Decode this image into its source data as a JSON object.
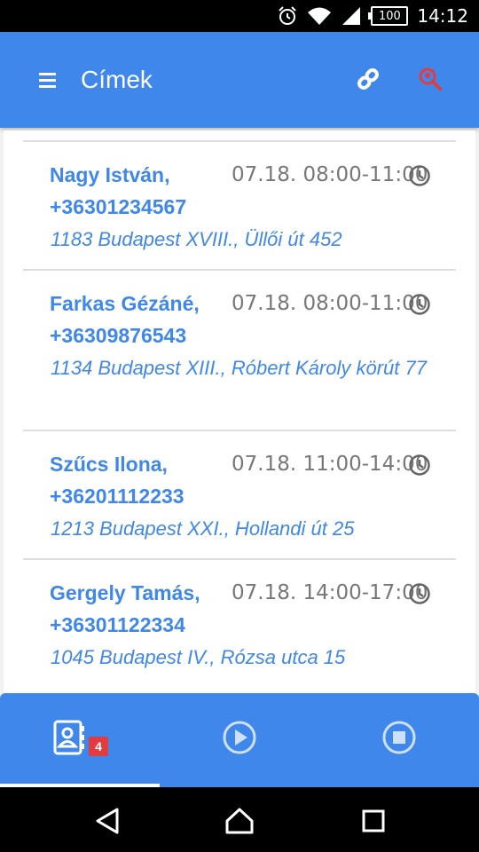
{
  "status_bar": {
    "battery": "100",
    "time": "14:12"
  },
  "appbar": {
    "title": "Címek",
    "icons": [
      "menu-icon",
      "link-icon",
      "search-location-icon"
    ],
    "colors": {
      "background": "#3f87ea",
      "search_icon": "#e03c41"
    }
  },
  "addresses": [
    {
      "name": "Nagy István,",
      "phone": "+36301234567",
      "time": "07.18. 08:00-11:00",
      "address": "1183 Budapest XVIII., Üllői út 452"
    },
    {
      "name": "Farkas Gézáné,",
      "phone": "+36309876543",
      "time": "07.18. 08:00-11:00",
      "address": "1134 Budapest XIII., Róbert Károly körút 77"
    },
    {
      "name": "Szűcs Ilona,",
      "phone": "+36201112233",
      "time": "07.18. 11:00-14:00",
      "address": "1213 Budapest XXI., Hollandi út 25"
    },
    {
      "name": "Gergely Tamás,",
      "phone": "+36301122334",
      "time": "07.18. 14:00-17:00",
      "address": "1045 Budapest IV., Rózsa utca 15"
    }
  ],
  "bottom_nav": {
    "tabs": [
      {
        "icon": "contacts-icon",
        "active": true
      },
      {
        "icon": "play-icon",
        "active": false
      },
      {
        "icon": "stop-icon",
        "active": false
      }
    ],
    "badge": "4"
  }
}
